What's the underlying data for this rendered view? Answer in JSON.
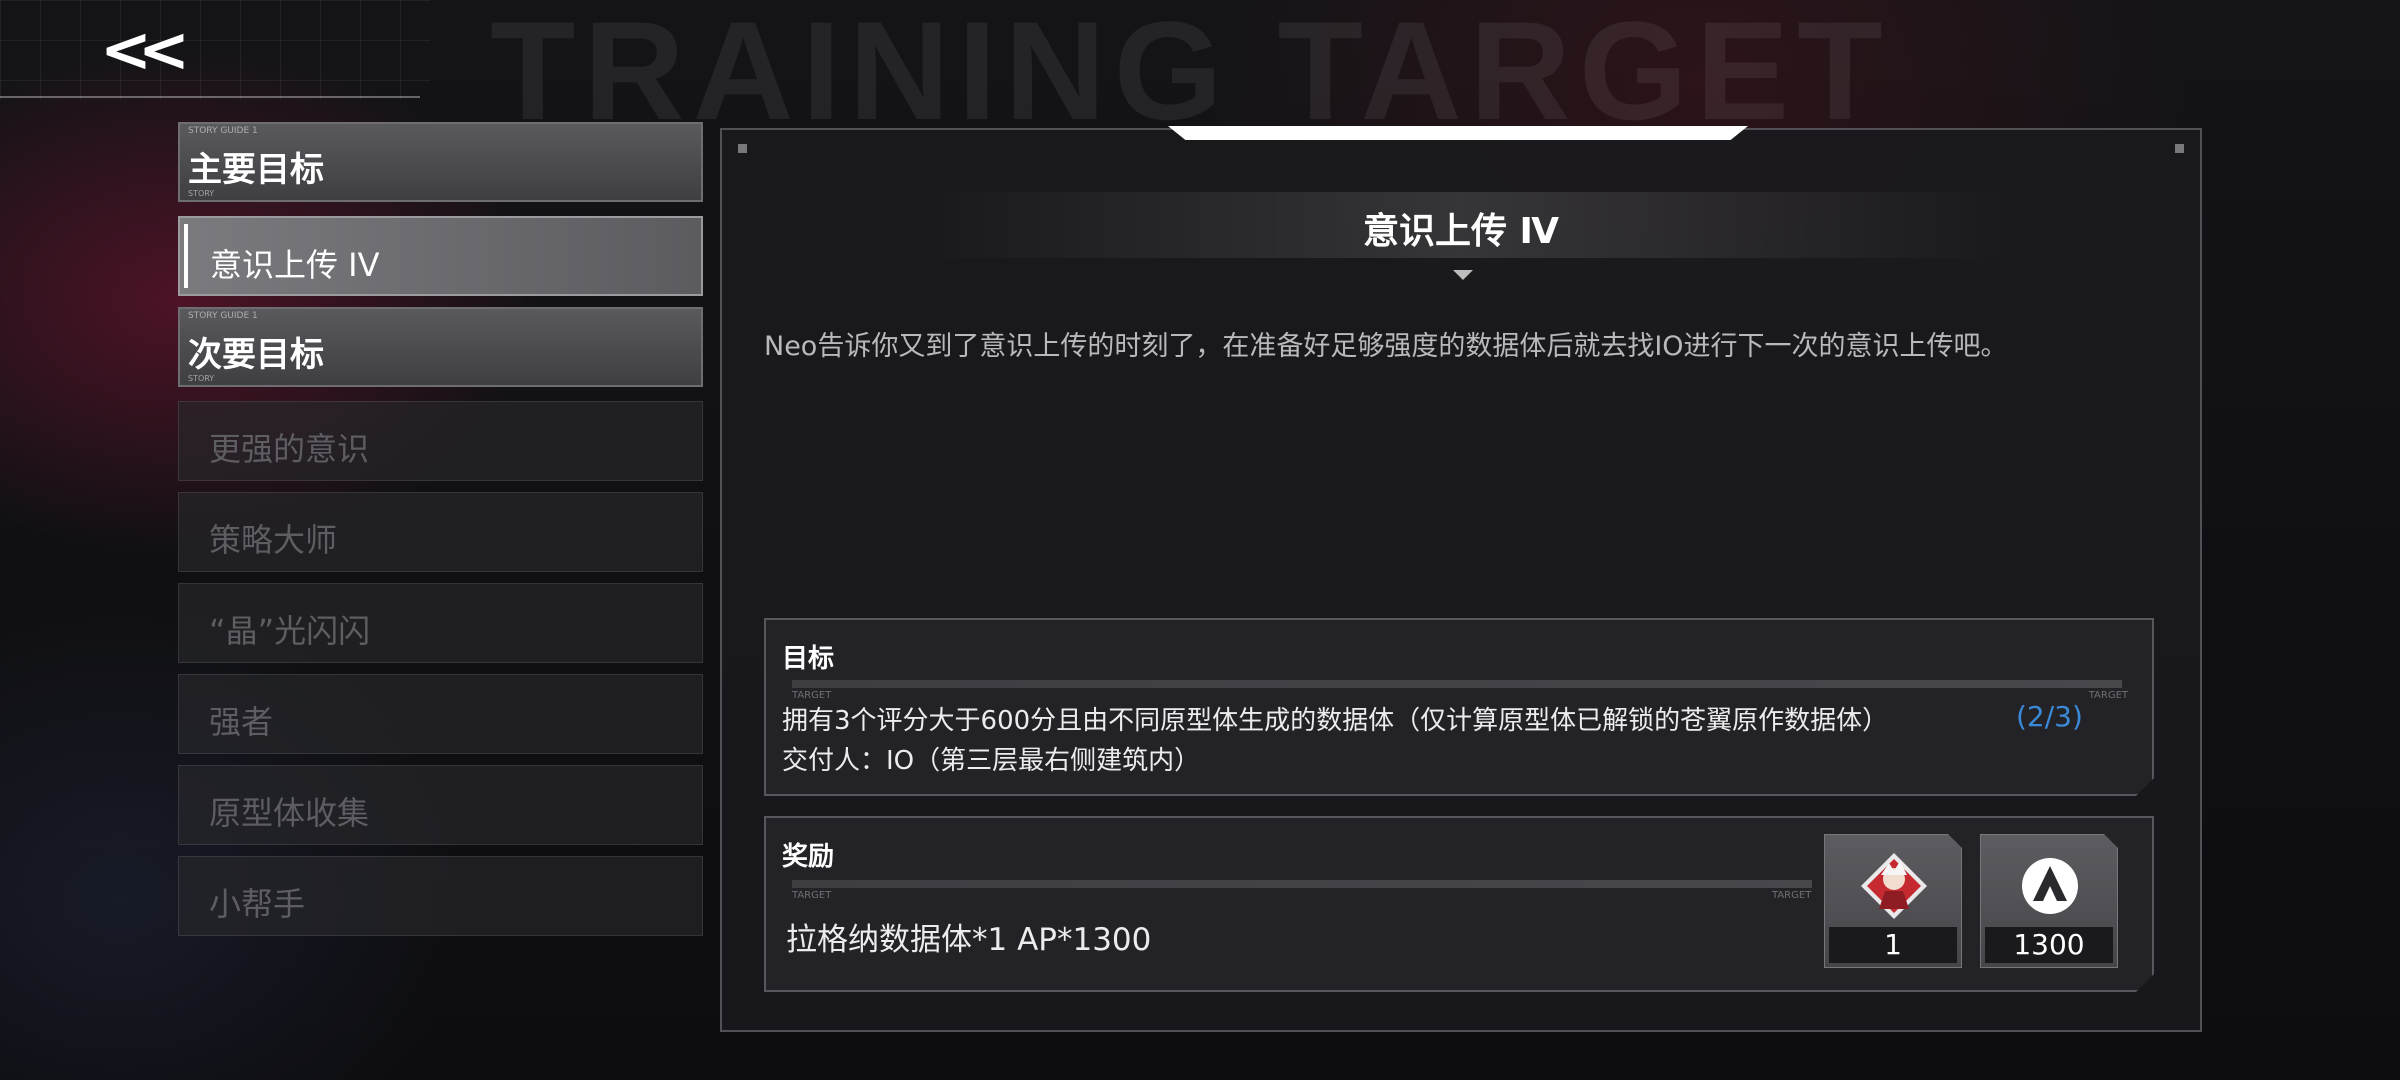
{
  "header": {
    "back_label": "<<",
    "bg_title": "TRAINING TARGET"
  },
  "sidebar": {
    "categories": [
      {
        "label": "主要目标",
        "tag_top": "STORY GUIDE 1",
        "tag_bottom": "STORY"
      },
      {
        "label": "次要目标",
        "tag_top": "STORY GUIDE 1",
        "tag_bottom": "STORY"
      }
    ],
    "items": [
      {
        "label": "意识上传 IV",
        "active": true
      },
      {
        "label": "更强的意识",
        "active": false
      },
      {
        "label": "策略大师",
        "active": false
      },
      {
        "label": "“晶”光闪闪",
        "active": false
      },
      {
        "label": "强者",
        "active": false
      },
      {
        "label": "原型体收集",
        "active": false
      },
      {
        "label": "小帮手",
        "active": false
      }
    ]
  },
  "panel": {
    "title": "意识上传 Ⅳ",
    "description": "Neo告诉你又到了意识上传的时刻了，在准备好足够强度的数据体后就去找IO进行下一次的意识上传吧。",
    "goal": {
      "heading": "目标",
      "tag": "TARGET",
      "text": "拥有3个评分大于600分且由不同原型体生成的数据体（仅计算原型体已解锁的苍翼原作数据体）",
      "progress": "(2/3)",
      "deliver": "交付人：IO（第三层最右侧建筑内）"
    },
    "reward": {
      "heading": "奖励",
      "tag": "TARGET",
      "text": "拉格纳数据体*1  AP*1300",
      "cards": [
        {
          "icon": "ragna-portrait-icon",
          "count": "1"
        },
        {
          "icon": "ap-logo-icon",
          "count": "1300"
        }
      ]
    }
  },
  "colors": {
    "progress_blue": "#3a8ad8",
    "active_item": "#7a7a7f",
    "disabled_text": "#5d5d62"
  }
}
